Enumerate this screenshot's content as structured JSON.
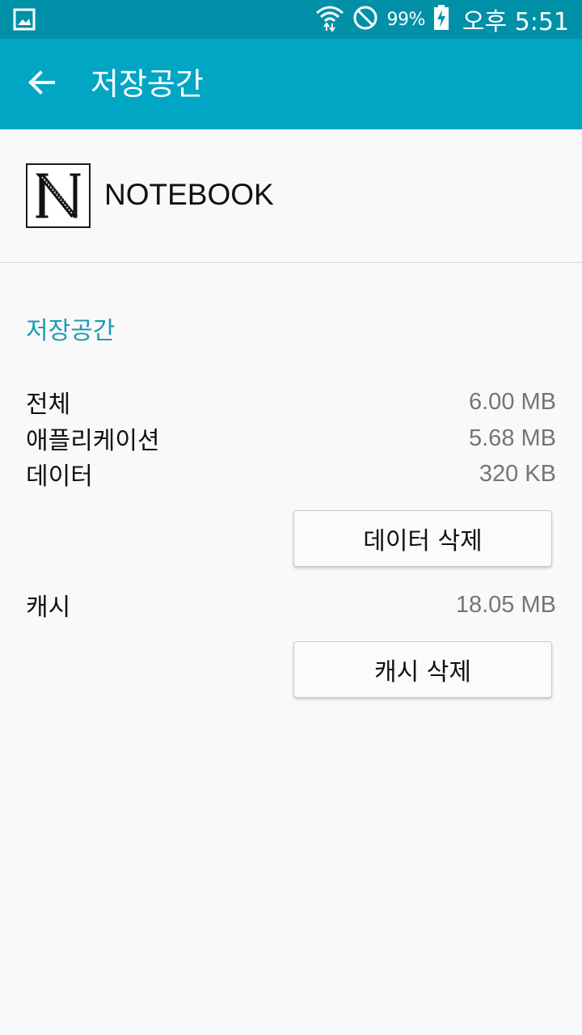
{
  "status_bar": {
    "battery_percent": "99%",
    "time": "오후 5:51",
    "icons": [
      "image-notification-icon",
      "wifi-icon",
      "do-not-disturb-icon",
      "battery-charging-icon"
    ]
  },
  "app_bar": {
    "title": "저장공간",
    "back_icon": "arrow-back-icon"
  },
  "app": {
    "name": "NOTEBOOK",
    "icon": "notebook-app-icon"
  },
  "storage": {
    "section_title": "저장공간",
    "rows": [
      {
        "label": "전체",
        "value": "6.00 MB"
      },
      {
        "label": "애플리케이션",
        "value": "5.68 MB"
      },
      {
        "label": "데이터",
        "value": "320 KB"
      }
    ],
    "clear_data_label": "데이터 삭제",
    "cache": {
      "label": "캐시",
      "value": "18.05 MB"
    },
    "clear_cache_label": "캐시 삭제"
  },
  "colors": {
    "status_bar": "#0090a8",
    "app_bar": "#00a6c4",
    "accent_text": "#1a9bb3",
    "background": "#f9f9f9"
  }
}
